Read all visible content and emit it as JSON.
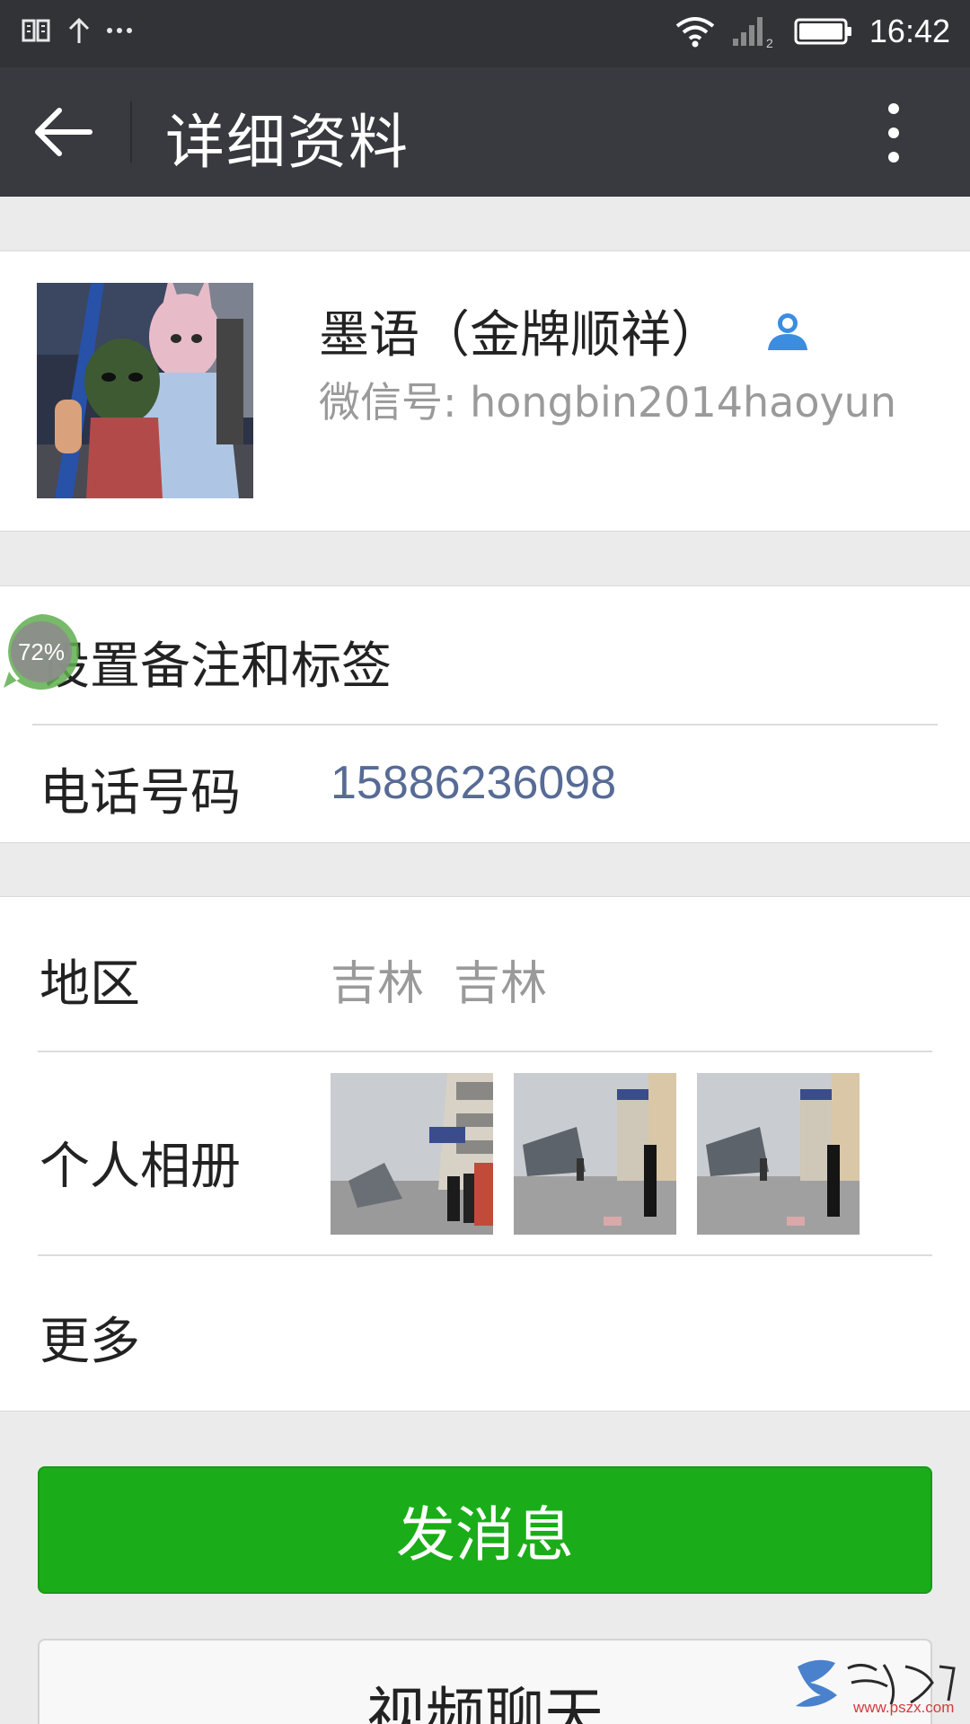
{
  "status_bar": {
    "time": "16:42",
    "left_icons": [
      "notification-icon",
      "upload-icon",
      "more-notifications-icon"
    ],
    "right_icons": [
      "wifi-icon",
      "signal-icon",
      "battery-icon"
    ],
    "signal_sim_label": "2"
  },
  "titlebar": {
    "title": "详细资料",
    "back_icon": "arrow-left-icon",
    "more_icon": "more-vertical-icon"
  },
  "profile": {
    "name": "墨语（金牌顺祥）",
    "wechat_id": "微信号: hongbin2014haoyun",
    "contact_icon": "contact-person-icon"
  },
  "remark_row": {
    "label": "设置备注和标签"
  },
  "phone_row": {
    "label": "电话号码",
    "value": "15886236098"
  },
  "region_row": {
    "label": "地区",
    "value": "吉林  吉林"
  },
  "album_row": {
    "label": "个人相册",
    "photo_count": 3
  },
  "more_row": {
    "label": "更多"
  },
  "buttons": {
    "send_message": "发消息",
    "video_chat": "视频聊天"
  },
  "float_badge": {
    "text": "72%"
  },
  "watermark": {
    "url": "www.pszx.com"
  },
  "colors": {
    "titlebar": "#393a3f",
    "statusbar": "#313336",
    "primary_button": "#1aad19",
    "phone_link": "#576b95",
    "secondary_text": "#9a9a9a"
  }
}
